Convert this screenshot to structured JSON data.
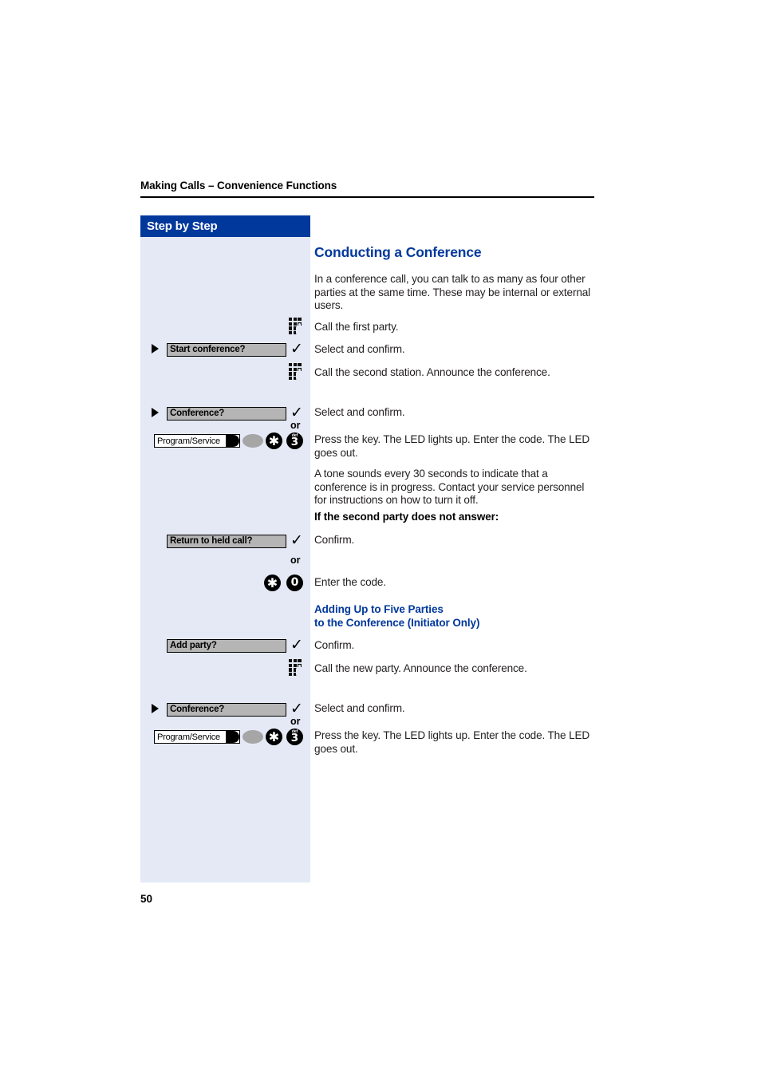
{
  "page": {
    "running_header": "Making Calls – Convenience Functions",
    "folio": "50",
    "accent_color": "#00389c",
    "sidebar_color": "#e4e9f5"
  },
  "sidebar": {
    "title": "Step by Step"
  },
  "content": {
    "title": "Conducting a Conference",
    "intro": "In a conference call, you can talk to as many as four other parties at the same time. These may be internal or external users.",
    "steps": [
      {
        "text": "Call the first party."
      },
      {
        "text": "Select and confirm."
      },
      {
        "text": "Call the second station. Announce the conference."
      },
      {
        "text": "Select and confirm."
      },
      {
        "text": "Press the key. The LED lights up. Enter the code. The LED goes out."
      }
    ],
    "note": "A tone sounds every 30 seconds to indicate that a conference is in progress. Contact your service personnel for instructions on how to turn it off.",
    "subheading_no_answer": "If the second party does not answer:",
    "confirm_label": "Confirm.",
    "enter_code_label": "Enter the code.",
    "section2_title_line1": "Adding Up to Five Parties",
    "section2_title_line2": "to the Conference (Initiator Only)",
    "confirm_label2": "Confirm.",
    "call_new_party": "Call the new party. Announce the conference.",
    "select_confirm2": "Select and confirm.",
    "press_key2": "Press the key. The LED lights up. Enter the code. The LED goes out."
  },
  "keys": {
    "softkey_start_conference": "Start conference?",
    "softkey_conference": "Conference?",
    "softkey_return_to_held_call": "Return to held call?",
    "softkey_add_party": "Add party?",
    "program_service": "Program/Service",
    "or": "or",
    "star": "✱",
    "digit_three": "3",
    "digit_three_letters": "def",
    "digit_zero": "0",
    "check": "✓",
    "keypad_icon": "keypad-dial-icon",
    "triangle_icon": "triangle-bullet-icon"
  }
}
